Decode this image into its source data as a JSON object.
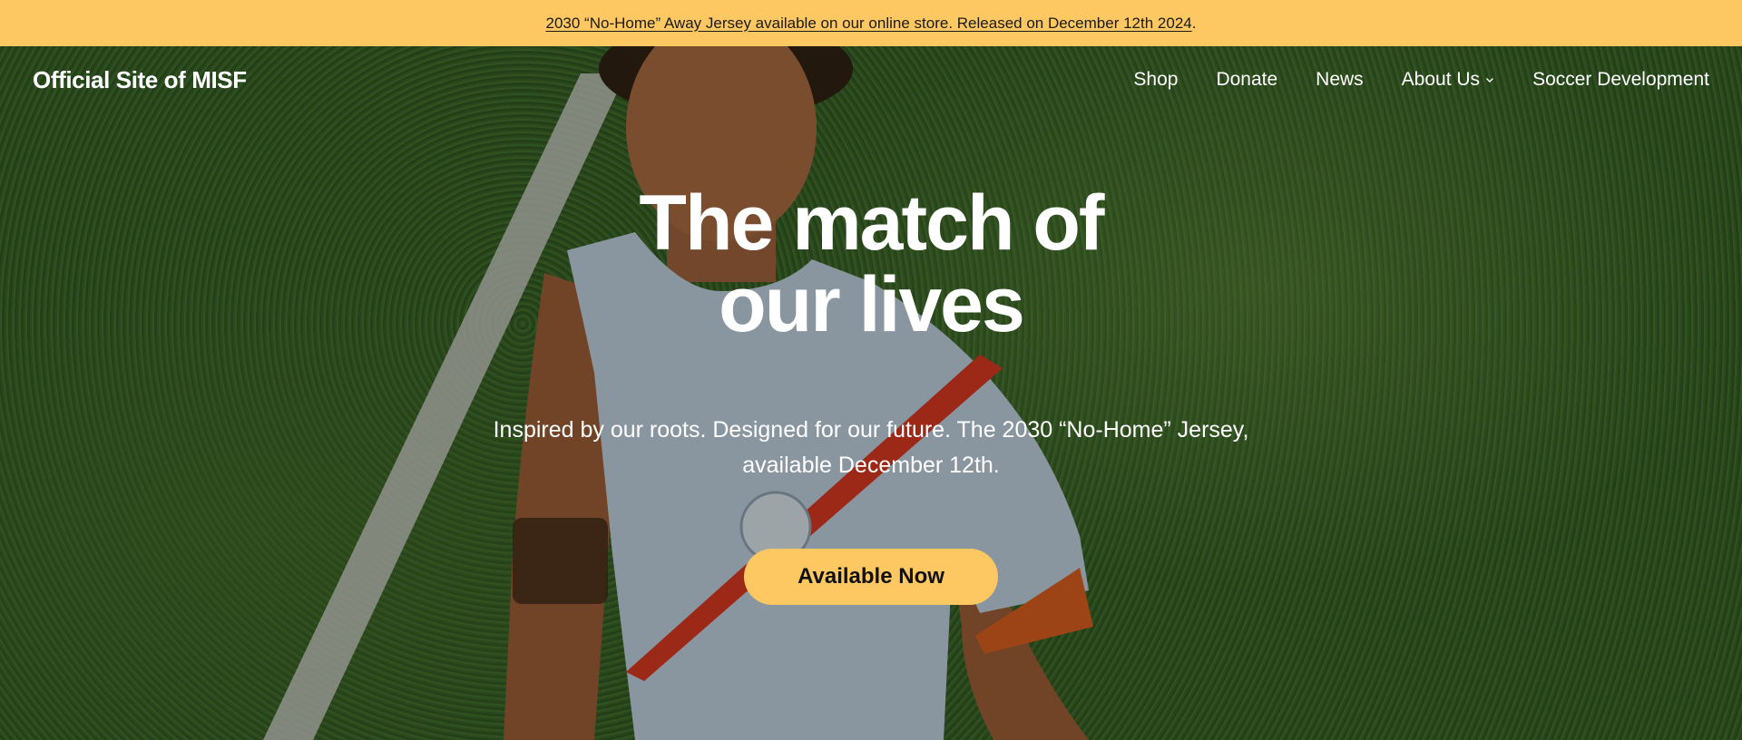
{
  "announcement": {
    "link_text": "2030 “No-Home” Away Jersey available on our online store. Released on December 12th 2024",
    "suffix": "."
  },
  "header": {
    "site_title": "Official Site of MISF",
    "nav": [
      {
        "label": "Shop"
      },
      {
        "label": "Donate"
      },
      {
        "label": "News"
      },
      {
        "label": "About Us",
        "icon": "chevron-down-icon"
      },
      {
        "label": "Soccer Development"
      }
    ]
  },
  "hero": {
    "title_line1": "The match of",
    "title_line2": "our lives",
    "subtitle_line1": "Inspired by our roots. Designed for our future. The 2030 “No-Home” Jersey,",
    "subtitle_line2": "available December 12th.",
    "cta_label": "Available Now"
  },
  "colors": {
    "announcement_bg": "#fdc862",
    "cta_bg": "#fdc862",
    "text_light": "#ffffff"
  }
}
